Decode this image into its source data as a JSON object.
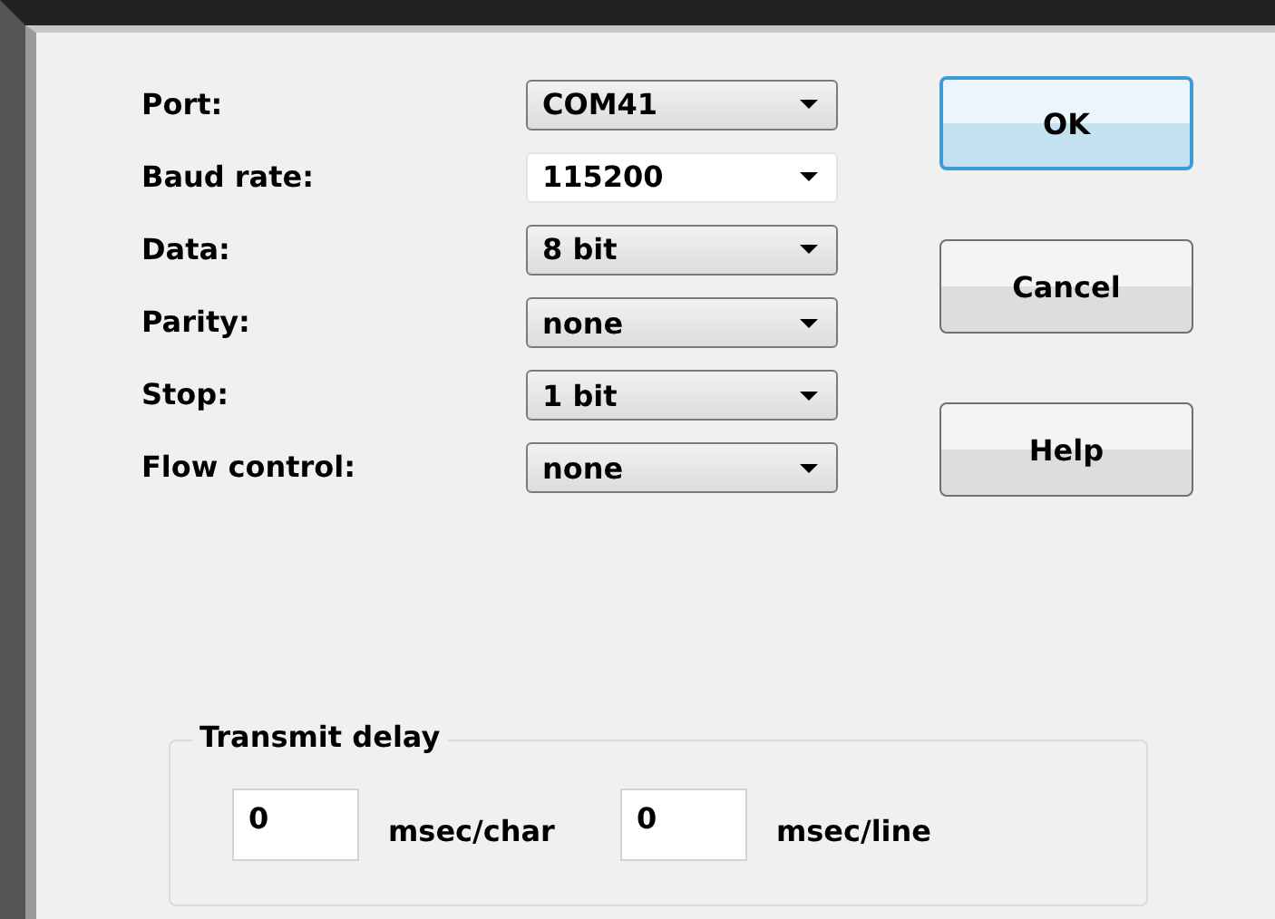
{
  "fields": [
    {
      "label": "Port:",
      "value": "COM41",
      "kind": "dropdown"
    },
    {
      "label": "Baud rate:",
      "value": "115200",
      "kind": "editable"
    },
    {
      "label": "Data:",
      "value": "8 bit",
      "kind": "dropdown"
    },
    {
      "label": "Parity:",
      "value": "none",
      "kind": "dropdown"
    },
    {
      "label": "Stop:",
      "value": "1 bit",
      "kind": "dropdown"
    },
    {
      "label": "Flow control:",
      "value": "none",
      "kind": "dropdown"
    }
  ],
  "buttons": [
    {
      "label": "OK",
      "default": true
    },
    {
      "label": "Cancel",
      "default": false
    },
    {
      "label": "Help",
      "default": false
    }
  ],
  "transmit_delay": {
    "title": "Transmit delay",
    "inputs": [
      {
        "value": "0",
        "unit": "msec/char"
      },
      {
        "value": "0",
        "unit": "msec/line"
      }
    ]
  }
}
